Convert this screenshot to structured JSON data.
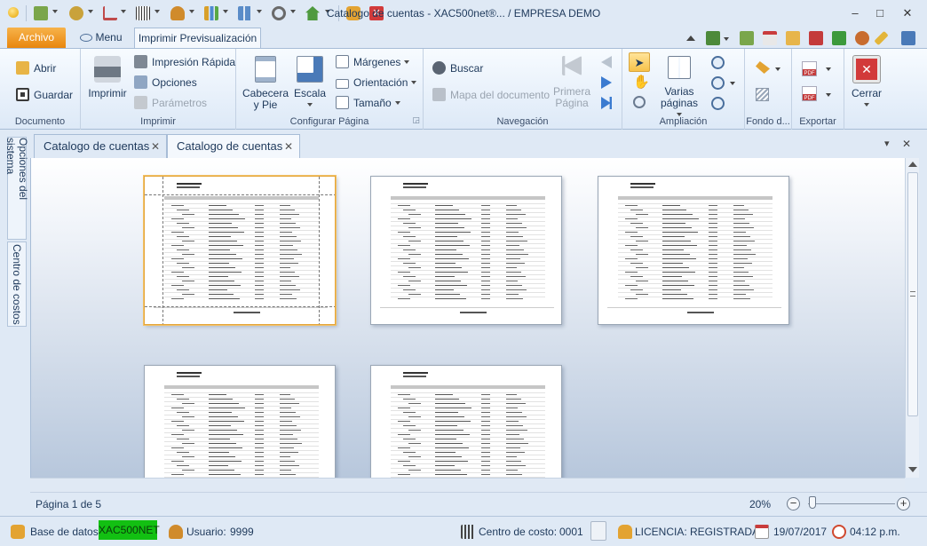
{
  "window": {
    "title": "Catalogo de cuentas - XAC500net®... / EMPRESA DEMO",
    "minimize": "–",
    "restore": "□",
    "close": "✕"
  },
  "tabs": {
    "archivo": "Archivo",
    "menu": "Menu",
    "imprimir": "Imprimir Previsualización"
  },
  "ribbon": {
    "documento": {
      "label": "Documento",
      "abrir": "Abrir",
      "guardar": "Guardar"
    },
    "imprimir": {
      "label": "Imprimir",
      "imprimir": "Imprimir",
      "impresion_rapida": "Impresión Rápida",
      "opciones": "Opciones",
      "parametros": "Parámetros"
    },
    "configurar": {
      "label": "Configurar Página",
      "cabecera_l1": "Cabecera",
      "cabecera_l2": "y Pie",
      "escala": "Escala",
      "margenes": "Márgenes",
      "orientacion": "Orientación",
      "tamano": "Tamaño"
    },
    "navegacion": {
      "label": "Navegación",
      "buscar": "Buscar",
      "mapa": "Mapa del documento",
      "primera_l1": "Primera",
      "primera_l2": "Página"
    },
    "ampliacion": {
      "label": "Ampliación",
      "varias_l1": "Varias",
      "varias_l2": "páginas"
    },
    "fondo": {
      "label": "Fondo d..."
    },
    "exportar": {
      "label": "Exportar",
      "pdf": "PDF"
    },
    "cerrar": {
      "label": "Cerrar"
    }
  },
  "side_tabs": {
    "opciones": "Opciones del sistema",
    "centro": "Centro de costos"
  },
  "doc_tabs": [
    {
      "label": "Catalogo de cuentas",
      "close": "✕"
    },
    {
      "label": "Catalogo de cuentas",
      "close": "✕"
    }
  ],
  "doc_tabs_controls": {
    "dropdown": "▾",
    "close": "✕"
  },
  "preview": {
    "page_indicator": "Página 1 de 5",
    "zoom": "20%",
    "zoom_fraction": 0.2,
    "zoom_out": "−",
    "zoom_in": "+"
  },
  "status": {
    "db_label": "Base de datos:",
    "db_value": "XAC500NET",
    "user_label": "Usuario:",
    "user_value": "9999",
    "cost_label": "Centro de costo:",
    "cost_value": "0001",
    "license": "LICENCIA: REGISTRADA",
    "date": "19/07/2017",
    "time": "04:12 p.m."
  },
  "colors": {
    "accent_orange": "#e8860e",
    "db_badge_green": "#12c012",
    "ribbon_text": "#1e395b"
  }
}
